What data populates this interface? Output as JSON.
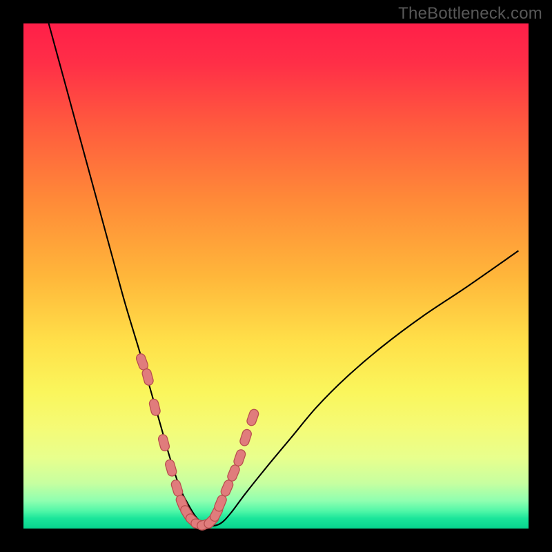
{
  "watermark": "TheBottleneck.com",
  "colors": {
    "frame": "#000000",
    "curve": "#000000",
    "dot_fill": "#e07c7c",
    "dot_stroke": "#b84f4f"
  },
  "chart_data": {
    "type": "line",
    "title": "",
    "xlabel": "",
    "ylabel": "",
    "xlim": [
      0,
      100
    ],
    "ylim": [
      0,
      100
    ],
    "grid": false,
    "legend": false,
    "series": [
      {
        "name": "bottleneck-curve",
        "x": [
          5,
          8,
          11,
          14,
          17,
          20,
          23,
          25,
          27,
          29,
          31,
          32.5,
          34,
          35.5,
          37,
          39,
          41,
          44,
          48,
          53,
          58,
          64,
          71,
          79,
          88,
          98
        ],
        "y": [
          100,
          89,
          78,
          67,
          56,
          45,
          35,
          28,
          21,
          14,
          8,
          5,
          2.5,
          1,
          0.5,
          1,
          3,
          7,
          12,
          18,
          24,
          30,
          36,
          42,
          48,
          55
        ]
      }
    ],
    "markers": {
      "name": "highlighted-points",
      "note": "salmon rounded markers clustered near the curve minimum on both branches",
      "x": [
        23.5,
        24.6,
        26.0,
        27.8,
        29.2,
        30.4,
        31.4,
        32.4,
        33.6,
        34.8,
        36.0,
        37.2,
        38.2,
        39.0,
        40.3,
        41.6,
        42.8,
        44.0,
        45.4
      ],
      "y": [
        33.0,
        30.0,
        24.0,
        17.0,
        12.0,
        8.0,
        5.0,
        3.0,
        1.5,
        0.8,
        0.8,
        1.5,
        3.0,
        5.0,
        8.0,
        11.0,
        14.0,
        18.0,
        22.0
      ]
    }
  }
}
